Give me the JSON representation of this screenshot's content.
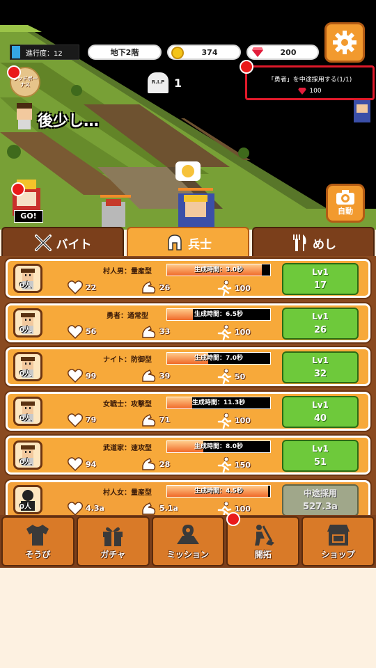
{
  "hud": {
    "progress_label": "進行度：12",
    "floor": "地下2階",
    "gold": "374",
    "gems": "200",
    "rip_label": "R.I.P",
    "rip_count": "1",
    "redbonus_label": "レッドボーナス",
    "near_text": "後少し…",
    "auto_label": "自動",
    "go_label": "GO!"
  },
  "mission": {
    "title": "「勇者」を中途採用する(1/1)",
    "cost": "100"
  },
  "tabs": [
    {
      "label": "バイト",
      "icon": "crossed-swords-icon",
      "active": false
    },
    {
      "label": "兵士",
      "icon": "helmet-icon",
      "active": true
    },
    {
      "label": "めし",
      "icon": "fork-knife-icon",
      "active": false
    }
  ],
  "units": [
    {
      "name": "村人男：量産型",
      "count": "0人",
      "time": "生成時間：3.0秒",
      "progress": 0.92,
      "hp": "22",
      "atk": "26",
      "spd": "100",
      "btn_top": "Lv1",
      "btn_bottom": "17",
      "locked": false
    },
    {
      "name": "勇者：通常型",
      "count": "0人",
      "time": "生成時間：6.5秒",
      "progress": 0.25,
      "hp": "56",
      "atk": "33",
      "spd": "100",
      "btn_top": "Lv1",
      "btn_bottom": "26",
      "locked": false
    },
    {
      "name": "ナイト：防御型",
      "count": "0人",
      "time": "生成時間：7.0秒",
      "progress": 0.4,
      "hp": "99",
      "atk": "39",
      "spd": "50",
      "btn_top": "Lv1",
      "btn_bottom": "32",
      "locked": false
    },
    {
      "name": "女戦士：攻撃型",
      "count": "0人",
      "time": "生成時間：11.3秒",
      "progress": 0.24,
      "hp": "79",
      "atk": "71",
      "spd": "100",
      "btn_top": "Lv1",
      "btn_bottom": "40",
      "locked": false
    },
    {
      "name": "武道家：速攻型",
      "count": "0人",
      "time": "生成時間：8.0秒",
      "progress": 0.35,
      "hp": "94",
      "atk": "28",
      "spd": "150",
      "btn_top": "Lv1",
      "btn_bottom": "51",
      "locked": false
    },
    {
      "name": "村人女：量産型",
      "count": "0人",
      "time": "生成時間：4.5秒",
      "progress": 0.98,
      "hp": "4.3a",
      "atk": "5.1a",
      "spd": "100",
      "btn_top": "中途採用",
      "btn_bottom": "527.3a",
      "locked": true
    }
  ],
  "nav": [
    {
      "label": "そうび",
      "icon": "shirt-icon"
    },
    {
      "label": "ガチャ",
      "icon": "gift-icon"
    },
    {
      "label": "ミッション",
      "icon": "map-icon"
    },
    {
      "label": "開拓",
      "icon": "digging-icon"
    },
    {
      "label": "ショップ",
      "icon": "shop-icon"
    }
  ],
  "colors": {
    "accent": "#f29a2e",
    "panel": "#8a4a20",
    "level_button": "#6ec93b",
    "alert": "#e0192a"
  }
}
